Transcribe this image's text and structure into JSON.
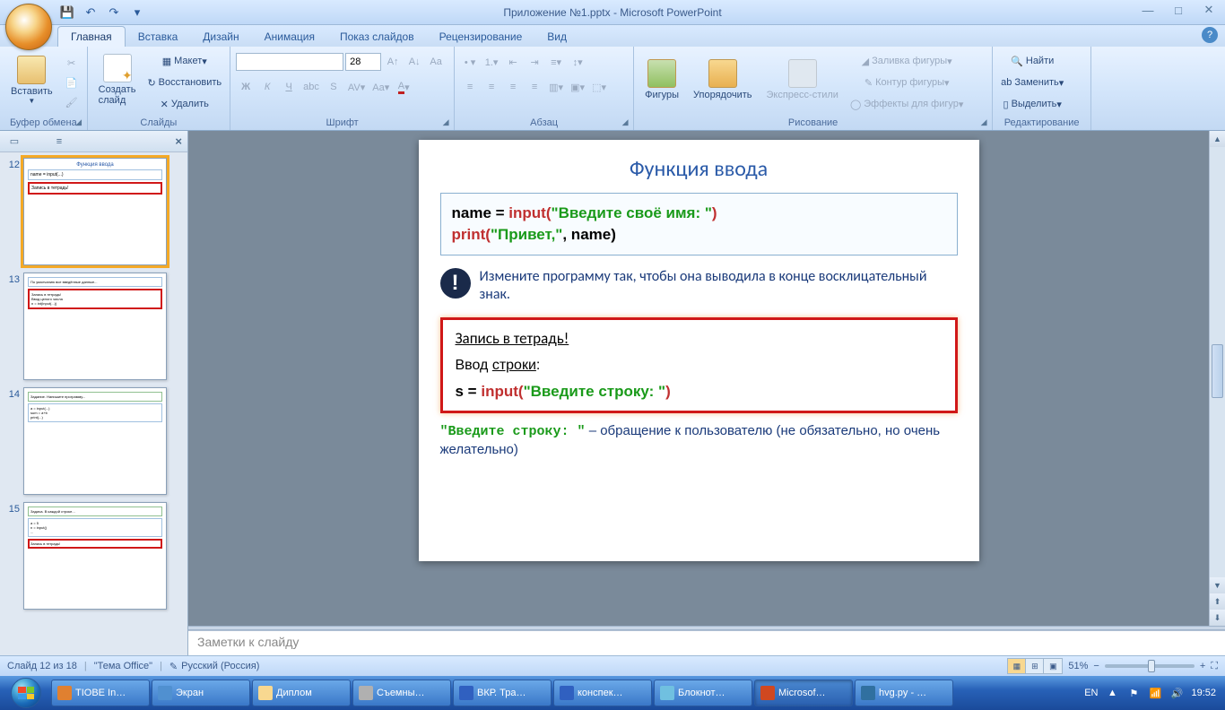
{
  "window": {
    "title": "Приложение №1.pptx - Microsoft PowerPoint"
  },
  "qat": {
    "save": "💾",
    "undo": "↶",
    "redo": "↷",
    "dd": "▾"
  },
  "tabs": [
    "Главная",
    "Вставка",
    "Дизайн",
    "Анимация",
    "Показ слайдов",
    "Рецензирование",
    "Вид"
  ],
  "ribbon": {
    "clipboard": {
      "label": "Буфер обмена",
      "paste": "Вставить"
    },
    "slides": {
      "label": "Слайды",
      "new": "Создать\nслайд",
      "layout": "Макет",
      "reset": "Восстановить",
      "delete": "Удалить"
    },
    "font": {
      "label": "Шрифт",
      "size": "28"
    },
    "para": {
      "label": "Абзац"
    },
    "draw": {
      "label": "Рисование",
      "shapes": "Фигуры",
      "arrange": "Упорядочить",
      "styles": "Экспресс-стили",
      "fill": "Заливка фигуры",
      "outline": "Контур фигуры",
      "effects": "Эффекты для фигур"
    },
    "edit": {
      "label": "Редактирование",
      "find": "Найти",
      "replace": "Заменить",
      "select": "Выделить"
    }
  },
  "side": {
    "thumbs": [
      {
        "n": "12",
        "selected": true
      },
      {
        "n": "13",
        "selected": false
      },
      {
        "n": "14",
        "selected": false
      },
      {
        "n": "15",
        "selected": false
      }
    ]
  },
  "slide": {
    "title": "Функция ввода",
    "code1_name": "name = ",
    "code1_input": "input",
    "code1_paren_open": "(",
    "code1_str1": "\"Введите своё имя: \"",
    "code1_paren_close": ")",
    "code2_print": "print",
    "code2_paren_open": "(",
    "code2_str": "\"Привет,\"",
    "code2_rest": ", name)",
    "hint": "Измените программу так, чтобы она выводила в конце восклицательный знак.",
    "red_hdr": "Запись в тетрадь!",
    "red_lbl_pre": "Ввод ",
    "red_lbl_und": "строки",
    "red_lbl_post": ":",
    "red_code_s": "s = ",
    "red_code_input": "input",
    "red_code_paren_open": "(",
    "red_code_str": "\"Введите строку: \"",
    "red_code_paren_close": ")",
    "note_str": "\"Введите строку: \"",
    "note_rest": " – обращение к пользователю (не обязательно, но очень желательно)"
  },
  "notes_placeholder": "Заметки к слайду",
  "status": {
    "slide": "Слайд 12 из 18",
    "theme": "\"Тема Office\"",
    "lang": "Русский (Россия)",
    "zoom": "51%"
  },
  "taskbar": {
    "items": [
      {
        "label": "TIOBE In…"
      },
      {
        "label": "Экран"
      },
      {
        "label": "Диплом"
      },
      {
        "label": "Съемны…"
      },
      {
        "label": "ВКР. Тра…"
      },
      {
        "label": "конспек…"
      },
      {
        "label": "Блокнот…"
      },
      {
        "label": "Microsof…",
        "active": true
      },
      {
        "label": "hvg.py - …"
      }
    ],
    "lang": "EN",
    "time": "19:52"
  }
}
